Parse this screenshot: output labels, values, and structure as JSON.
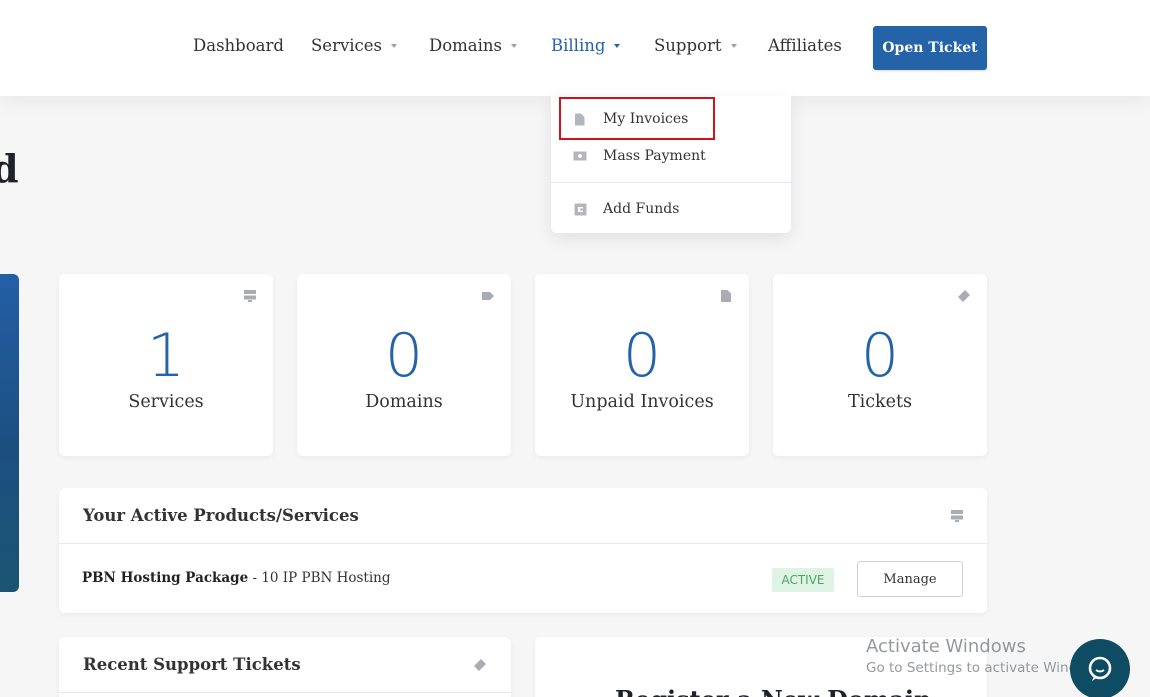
{
  "nav": {
    "items": [
      {
        "label": "Dashboard",
        "dropdown": false
      },
      {
        "label": "Services",
        "dropdown": true
      },
      {
        "label": "Domains",
        "dropdown": true
      },
      {
        "label": "Billing",
        "dropdown": true,
        "active": true
      },
      {
        "label": "Support",
        "dropdown": true
      },
      {
        "label": "Affiliates",
        "dropdown": false
      }
    ],
    "open_ticket": "Open Ticket"
  },
  "billing_menu": {
    "items": [
      {
        "label": "My Invoices",
        "icon": "file-icon",
        "highlighted": true
      },
      {
        "label": "Mass Payment",
        "icon": "money-icon"
      },
      {
        "label": "Add Funds",
        "icon": "wallet-icon"
      }
    ]
  },
  "page": {
    "title_fragment": "d"
  },
  "stats": [
    {
      "value": "1",
      "label": "Services",
      "icon": "server-icon"
    },
    {
      "value": "0",
      "label": "Domains",
      "icon": "tag-icon"
    },
    {
      "value": "0",
      "label": "Unpaid Invoices",
      "icon": "file-icon"
    },
    {
      "value": "0",
      "label": "Tickets",
      "icon": "ticket-icon"
    }
  ],
  "products": {
    "title": "Your Active Products/Services",
    "rows": [
      {
        "name": "PBN Hosting Package",
        "detail": " - 10 IP PBN Hosting",
        "status": "ACTIVE",
        "action": "Manage"
      }
    ]
  },
  "tickets": {
    "title": "Recent Support Tickets"
  },
  "register": {
    "title": "Register a New Domain"
  },
  "watermark": {
    "line1": "Activate Windows",
    "line2": "Go to Settings to activate Windows."
  },
  "colors": {
    "accent": "#2563a8",
    "highlight": "#d0121b",
    "active_badge_bg": "#dff3e4",
    "active_badge_text": "#4ca765"
  }
}
